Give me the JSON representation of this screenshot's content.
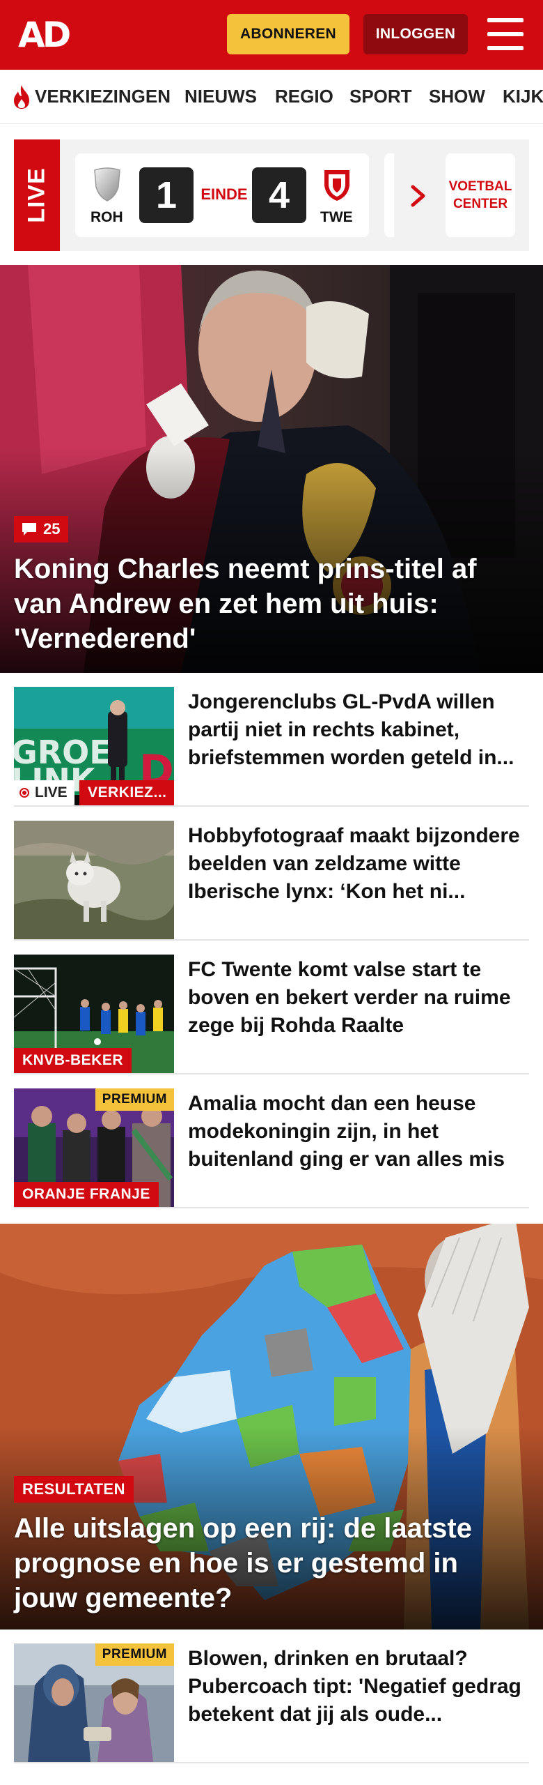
{
  "header": {
    "logo": "AD",
    "subscribe_label": "ABONNEREN",
    "login_label": "INLOGGEN",
    "brand_color": "#d10a11",
    "accent_color": "#f5c33b"
  },
  "nav": {
    "items": [
      "VERKIEZINGEN",
      "NIEUWS",
      "REGIO",
      "SPORT",
      "SHOW",
      "KIJK"
    ]
  },
  "live": {
    "label": "LIVE",
    "match": {
      "home_team": "ROH",
      "home_score": "1",
      "status": "EINDE",
      "away_score": "4",
      "away_team": "TWE"
    },
    "voetbal_center_line1": "VOETBAL",
    "voetbal_center_line2": "CENTER"
  },
  "hero": {
    "comment_count": "25",
    "title": "Koning Charles neemt prins-titel af van Andrew en zet hem uit huis: 'Vernederend'"
  },
  "articles": [
    {
      "title": "Jongerenclubs GL-PvdA willen partij niet in rechts kabinet, briefstemmen worden geteld in...",
      "live_label": "LIVE",
      "tag": "VERKIEZ...",
      "premium": ""
    },
    {
      "title": "Hobbyfotograaf maakt bijzondere beelden van zeldzame witte Iberische lynx: ‘Kon het ni...",
      "tag": "",
      "premium": ""
    },
    {
      "title": "FC Twente komt valse start te boven en bekert verder na ruime zege bij Rohda Raalte",
      "tag": "KNVB-BEKER",
      "premium": ""
    },
    {
      "title": "Amalia mocht dan een heuse modekoningin zijn, in het buitenland ging er van alles mis",
      "tag": "ORANJE FRANJE",
      "premium": "PREMIUM"
    }
  ],
  "map_hero": {
    "tag": "RESULTATEN",
    "title": "Alle uitslagen op een rij: de laatste prognose en hoe is er gestemd in jouw gemeente?"
  },
  "articles2": [
    {
      "title": "Blowen, drinken en brutaal? Pubercoach tipt: 'Negatief gedrag betekent dat jij als oude...",
      "premium": "PREMIUM"
    }
  ]
}
